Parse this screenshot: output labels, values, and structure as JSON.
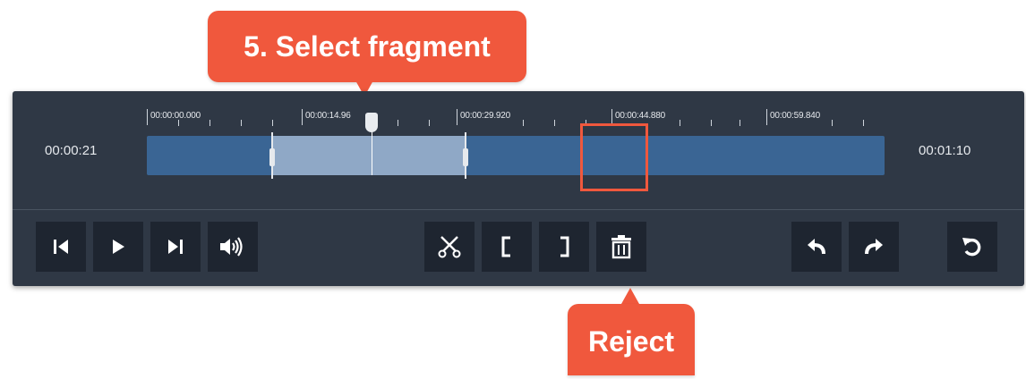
{
  "callouts": {
    "select_fragment": "5. Select fragment",
    "reject": "Reject"
  },
  "timeline": {
    "current_time": "00:00:21",
    "total_time": "00:01:10",
    "ruler_labels": [
      "00:00:00.000",
      "00:00:14.96",
      "00:00:29.920",
      "00:00:44.880",
      "00:00:59.840"
    ]
  },
  "controls": {
    "playback": [
      {
        "name": "previous-frame-button",
        "icon": "skip-back-icon"
      },
      {
        "name": "play-button",
        "icon": "play-icon"
      },
      {
        "name": "next-frame-button",
        "icon": "skip-forward-icon"
      },
      {
        "name": "volume-button",
        "icon": "volume-icon"
      }
    ],
    "editing": [
      {
        "name": "split-button",
        "icon": "scissors-icon"
      },
      {
        "name": "mark-in-button",
        "icon": "bracket-left-icon"
      },
      {
        "name": "mark-out-button",
        "icon": "bracket-right-icon"
      },
      {
        "name": "reject-button",
        "icon": "trash-icon"
      }
    ],
    "history": [
      {
        "name": "undo-button",
        "icon": "undo-icon"
      },
      {
        "name": "redo-button",
        "icon": "redo-icon"
      },
      {
        "name": "reset-button",
        "icon": "reset-icon"
      }
    ]
  },
  "colors": {
    "accent": "#f0583d",
    "panel": "#2f3845",
    "button": "#1e2530",
    "track": "#3a6594",
    "selection": "#8fa8c6"
  }
}
